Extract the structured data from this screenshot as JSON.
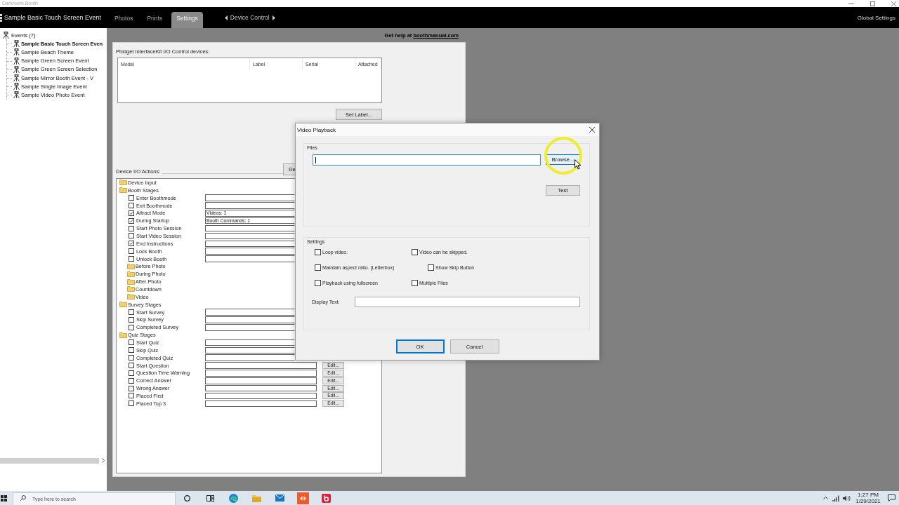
{
  "window": {
    "title": "Darkroom Booth"
  },
  "header": {
    "event_name": "Sample Basic Touch Screen Event",
    "tabs": [
      {
        "label": "Photos",
        "selected": false
      },
      {
        "label": "Prints",
        "selected": false
      },
      {
        "label": "Settings",
        "selected": true
      }
    ],
    "device_control": "Device Control",
    "global_settings": "Global Settings"
  },
  "sidebar": {
    "events": {
      "label": "Events (7)",
      "children": [
        {
          "label": "Sample Basic Touch Screen Even",
          "selected": true
        },
        {
          "label": "Sample Beach Theme",
          "selected": false
        },
        {
          "label": "Sample Green Screen Event",
          "selected": false
        },
        {
          "label": "Sample Green Screen Selection",
          "selected": false
        },
        {
          "label": "Sample Mirror Booth Event - V",
          "selected": false
        },
        {
          "label": "Sample Single Image Event",
          "selected": false
        },
        {
          "label": "Sample Video Photo Event",
          "selected": false
        }
      ]
    }
  },
  "help": {
    "text": "Get help at",
    "link": "boothmanual.com"
  },
  "devices": {
    "label": "Phidget InterfaceKit I/O Control devices:",
    "columns": [
      "Model",
      "Label",
      "Serial",
      "Attached"
    ],
    "set_label_button": "Set Label...",
    "cut_button": "De"
  },
  "actions": {
    "label": "Device I/O Actions:",
    "tree": [
      {
        "kind": "folder",
        "label": "Device Input"
      },
      {
        "kind": "folder",
        "label": "Booth Stages",
        "children": [
          {
            "kind": "action",
            "label": "Enter Boothmode",
            "checked": false
          },
          {
            "kind": "action",
            "label": "Exit Boothmode",
            "checked": false
          },
          {
            "kind": "action",
            "label": "Attract Mode",
            "checked": true,
            "value": "Videos: 1"
          },
          {
            "kind": "action",
            "label": "During Startup",
            "checked": true,
            "value": "Booth Commands: 1"
          },
          {
            "kind": "action",
            "label": "Start Photo Session",
            "checked": false
          },
          {
            "kind": "action",
            "label": "Start Video Session",
            "checked": false
          },
          {
            "kind": "action",
            "label": "End Instructions",
            "checked": true
          },
          {
            "kind": "action",
            "label": "Lock Booth",
            "checked": false
          },
          {
            "kind": "action",
            "label": "Unlock Booth",
            "checked": false
          },
          {
            "kind": "folder",
            "label": "Before Photo"
          },
          {
            "kind": "folder",
            "label": "During Photo"
          },
          {
            "kind": "folder",
            "label": "After Photo"
          },
          {
            "kind": "folder",
            "label": "Countdown"
          },
          {
            "kind": "folder",
            "label": "Video"
          }
        ]
      },
      {
        "kind": "folder",
        "label": "Survey Stages",
        "children": [
          {
            "kind": "action",
            "label": "Start Survey",
            "checked": false
          },
          {
            "kind": "action",
            "label": "Skip Survey",
            "checked": false
          },
          {
            "kind": "action",
            "label": "Completed Survey",
            "checked": false
          }
        ]
      },
      {
        "kind": "folder",
        "label": "Quiz Stages",
        "children": [
          {
            "kind": "action",
            "label": "Start Quiz",
            "checked": false
          },
          {
            "kind": "action",
            "label": "Skip Quiz",
            "checked": false
          },
          {
            "kind": "action",
            "label": "Completed Quiz",
            "checked": false
          },
          {
            "kind": "action",
            "label": "Start Question",
            "checked": false,
            "edit": "Edit..."
          },
          {
            "kind": "action",
            "label": "Question Time Warning",
            "checked": false,
            "edit": "Edit..."
          },
          {
            "kind": "action",
            "label": "Correct Answer",
            "checked": false,
            "edit": "Edit..."
          },
          {
            "kind": "action",
            "label": "Wrong Answer",
            "checked": false,
            "edit": "Edit..."
          },
          {
            "kind": "action",
            "label": "Placed First",
            "checked": false,
            "edit": "Edit..."
          },
          {
            "kind": "action",
            "label": "Placed Top 3",
            "checked": false,
            "edit": "Edit..."
          }
        ]
      }
    ]
  },
  "dialog": {
    "title": "Video Playback",
    "files": {
      "label": "Files",
      "focused": true,
      "browse": {
        "label": "Browse...",
        "hovered": true
      },
      "test": "Test"
    },
    "settings": {
      "label": "Settings",
      "left": [
        {
          "label": "Loop video.",
          "checked": false
        },
        {
          "label": "Maintain aspect ratio. (Letterbox)",
          "checked": false
        },
        {
          "label": "Playback using fullscreen",
          "checked": false
        }
      ],
      "right": [
        {
          "label": "Video can be skipped.",
          "checked": false,
          "children": [
            {
              "label": "Show Skip Button",
              "checked": false
            }
          ]
        },
        {
          "label": "Multiple Files",
          "checked": false
        }
      ],
      "display_text": "Display Text:"
    },
    "buttons": [
      {
        "label": "OK",
        "default": true
      },
      {
        "label": "Cancel",
        "default": false
      }
    ]
  },
  "taskbar": {
    "search": {
      "placeholder": "Type here to search"
    },
    "time": "1:27 PM",
    "date": "1/29/2021"
  }
}
